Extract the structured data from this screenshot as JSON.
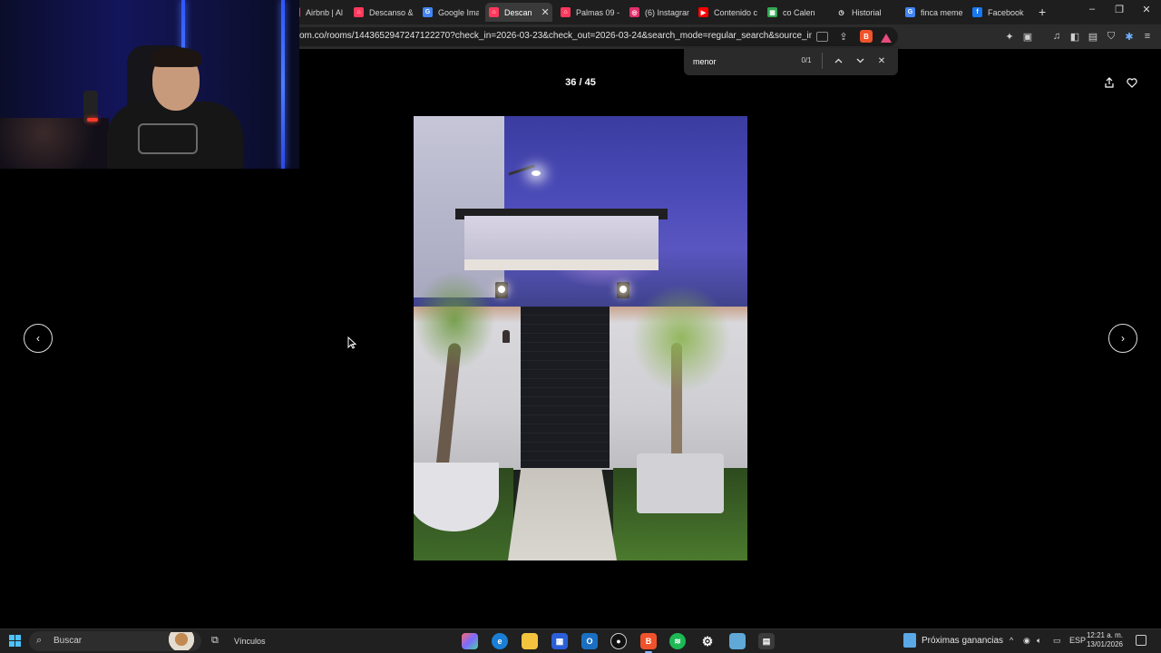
{
  "browser": {
    "tabs": [
      {
        "label": "Airbnb | Alo",
        "favicon": "airbnb-icon",
        "color": "#ff385c",
        "active": false
      },
      {
        "label": "Descanso &",
        "favicon": "airbnb-icon",
        "color": "#ff385c",
        "active": false
      },
      {
        "label": "Google Ima",
        "favicon": "google-icon",
        "color": "#4285f4",
        "active": false
      },
      {
        "label": "Descan",
        "favicon": "airbnb-icon",
        "color": "#ff385c",
        "active": true
      },
      {
        "label": "Palmas 09 -",
        "favicon": "airbnb-icon",
        "color": "#ff385c",
        "active": false
      },
      {
        "label": "(6) Instagran",
        "favicon": "instagram-icon",
        "color": "#e1306c",
        "active": false
      },
      {
        "label": "Contenido c",
        "favicon": "youtube-icon",
        "color": "#ff0000",
        "active": false
      },
      {
        "label": "co Calen",
        "favicon": "calendar-icon",
        "color": "#34a853",
        "active": false
      },
      {
        "label": "Historial",
        "favicon": "history-icon",
        "color": "#888888",
        "active": false
      },
      {
        "label": "finca meme",
        "favicon": "google-icon",
        "color": "#4285f4",
        "active": false
      },
      {
        "label": "Facebook",
        "favicon": "facebook-icon",
        "color": "#1877f2",
        "active": false
      }
    ],
    "url": "om.co/rooms/1443652947247122270?check_in=2026-03-23&check_out=2026-03-24&search_mode=regular_search&source_impressio..."
  },
  "find_bar": {
    "query": "menor",
    "count": "0/1"
  },
  "gallery": {
    "counter": "36 / 45",
    "prev_symbol": "‹",
    "next_symbol": "›"
  },
  "taskbar": {
    "search_placeholder": "Buscar",
    "links_label": "Vínculos",
    "widget_text": "Próximas ganancias",
    "language": "ESP",
    "time": "12:21 a. m.",
    "date": "13/01/2026"
  },
  "colors": {
    "accent": "#ff385c",
    "windows_blue": "#4cc2ff"
  }
}
